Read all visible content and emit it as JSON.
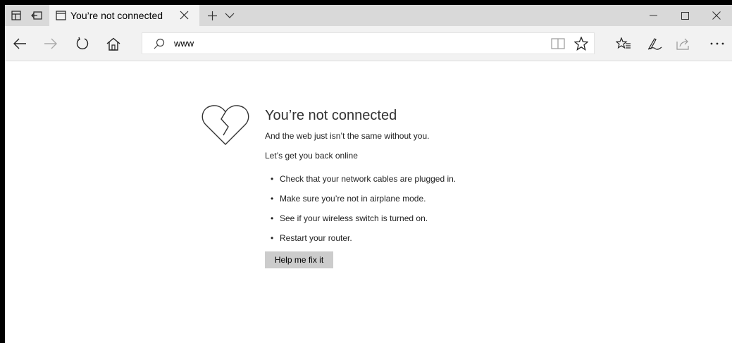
{
  "tab": {
    "title": "You’re not connected"
  },
  "window_controls": [
    "minimize",
    "maximize",
    "close"
  ],
  "address_bar": {
    "value": "www"
  },
  "error": {
    "title": "You’re not connected",
    "subtitle": "And the web just isn’t the same without you.",
    "prompt": "Let’s get you back online",
    "tips": [
      "Check that your network cables are plugged in.",
      "Make sure you’re not in airplane mode.",
      "See if your wireless switch is turned on.",
      "Restart your router."
    ],
    "button_label": "Help me fix it"
  },
  "icons": {
    "titlebar": [
      "tab-preview-icon",
      "set-aside-tabs-icon",
      "tab-page-icon",
      "close-tab-icon",
      "new-tab-icon",
      "tab-list-icon"
    ],
    "navbar": [
      "back-icon",
      "forward-icon",
      "refresh-icon",
      "home-icon",
      "search-icon",
      "reading-view-icon",
      "favorite-star-icon",
      "favorites-hub-icon",
      "web-note-icon",
      "share-icon",
      "more-icon"
    ],
    "content": [
      "broken-heart-icon"
    ]
  },
  "colors": {
    "titlebar_bg": "#d9d9d9",
    "tab_bg": "#f2f2f2",
    "navbar_bg": "#f2f2f2",
    "button_bg": "#cccccc"
  }
}
